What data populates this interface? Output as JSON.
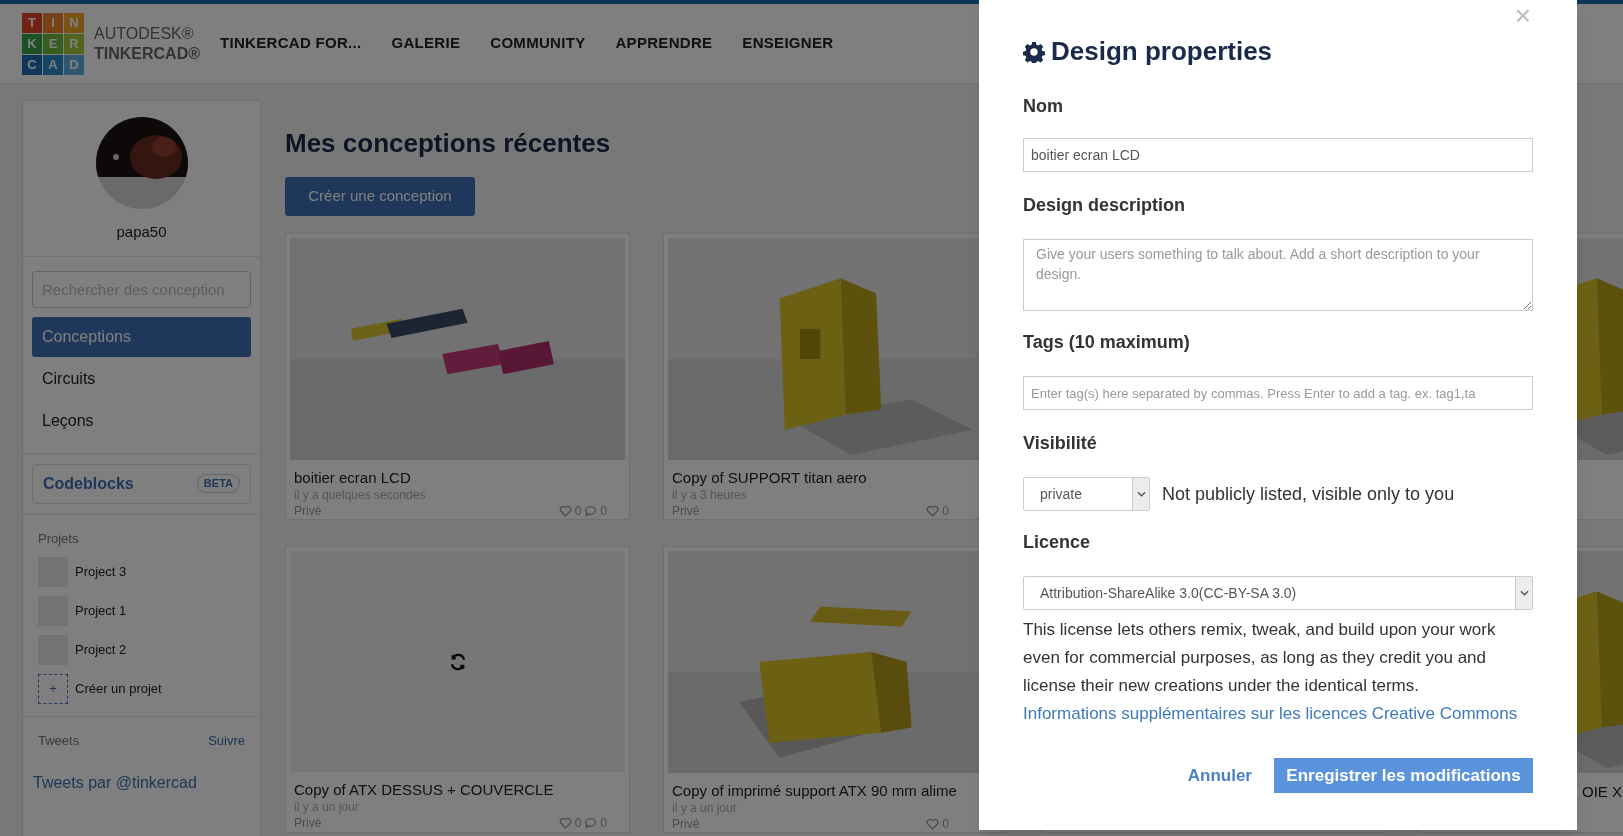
{
  "header": {
    "logo_letters": [
      "T",
      "I",
      "N",
      "K",
      "E",
      "R",
      "C",
      "A",
      "D"
    ],
    "brand_top": "AUTODESK®",
    "brand_bottom": "TINKERCAD®",
    "nav": [
      "TINKERCAD FOR...",
      "GALERIE",
      "COMMUNITY",
      "APPRENDRE",
      "ENSEIGNER"
    ]
  },
  "sidebar": {
    "username": "papa50",
    "search_placeholder": "Rechercher des conception",
    "nav": [
      {
        "label": "Conceptions",
        "selected": true
      },
      {
        "label": "Circuits",
        "selected": false
      },
      {
        "label": "Leçons",
        "selected": false
      }
    ],
    "codeblocks": {
      "label": "Codeblocks",
      "badge": "BETA"
    },
    "projects_title": "Projets",
    "projects": [
      "Project 3",
      "Project 1",
      "Project 2"
    ],
    "create_project": {
      "icon": "+",
      "label": "Créer un projet"
    },
    "tweets_title": "Tweets",
    "follow": "Suivre",
    "tweets_link": "Tweets par @tinkercad"
  },
  "main": {
    "title": "Mes conceptions récentes",
    "create_button": "Créer une conception",
    "cards": [
      {
        "kind": "picture",
        "title": "boitier ecran LCD",
        "time": "il y a quelques secondes",
        "privacy": "Privé",
        "likes": "0",
        "comments": "0"
      },
      {
        "kind": "picture",
        "title": "Copy of SUPPORT titan aero",
        "time": "il y a 3 heures",
        "privacy": "Privé",
        "likes": "0"
      },
      {
        "kind": "loading",
        "title": "Copy of ATX DESSUS + COUVERCLE",
        "time": "il y a un jour",
        "privacy": "Privé",
        "likes": "0",
        "comments": "0"
      },
      {
        "kind": "picture",
        "title": "Copy of imprimé support ATX 90 mm alime",
        "time": "il y a un jour",
        "privacy": "Privé",
        "likes": "0"
      }
    ],
    "peek_title": "OIE X"
  },
  "dialog": {
    "close": "×",
    "title": "Design properties",
    "name_label": "Nom",
    "name_value": "boitier ecran LCD",
    "description_label": "Design description",
    "description_placeholder": "Give your users something to talk about. Add a short description to your design.",
    "tags_label": "Tags (10 maximum)",
    "tags_placeholder": "Enter tag(s) here separated by commas. Press Enter to add a tag. ex. tag1,ta",
    "visibility_label": "Visibilité",
    "visibility_value": "private",
    "visibility_note": "Not publicly listed, visible only to you",
    "licence_label": "Licence",
    "licence_value": "Attribution-ShareAlike 3.0(CC-BY-SA 3.0)",
    "licence_text": "This license lets others remix, tweak, and build upon your work even for commercial purposes, as long as they credit you and license their new creations under the identical terms.",
    "licence_link": "Informations supplémentaires sur les licences Creative Commons",
    "cancel": "Annuler",
    "save": "Enregistrer les modifications"
  }
}
